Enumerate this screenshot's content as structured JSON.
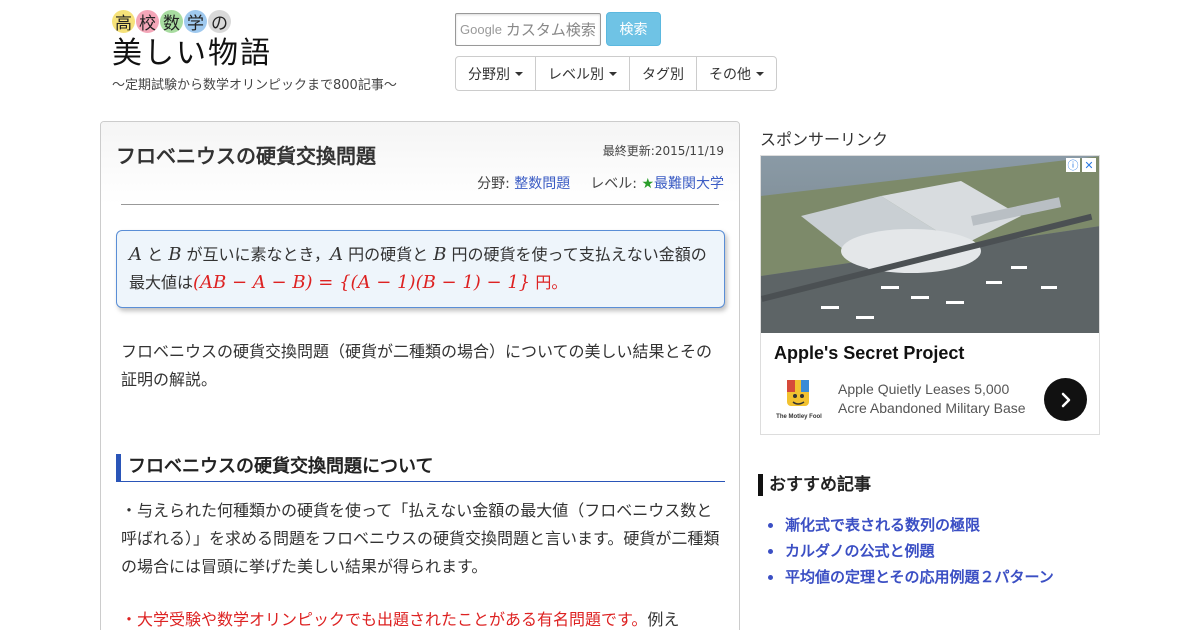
{
  "header": {
    "logo_chars": [
      "高",
      "校",
      "数",
      "学",
      "の"
    ],
    "logo_char_colors": [
      "#f6e27a",
      "#f4a6b8",
      "#a8dca0",
      "#9fc9ef",
      "#d9d9d9"
    ],
    "logo_title": "美しい物語",
    "tagline": "～定期試験から数学オリンピックまで800記事～",
    "search_brand": "Google",
    "search_placeholder": "カスタム検索",
    "search_button": "検索",
    "nav": [
      "分野別",
      "レベル別",
      "タグ別",
      "その他"
    ],
    "nav_has_caret": [
      true,
      true,
      false,
      true
    ]
  },
  "article": {
    "title": "フロベニウスの硬貨交換問題",
    "updated": "最終更新:2015/11/19",
    "category_label": "分野:",
    "category_value": "整数問題",
    "level_label": "レベル:",
    "level_star": "★",
    "level_value": "最難関大学",
    "theorem": {
      "var_a": "A",
      "t1": " と ",
      "var_b": "B",
      "t2": " が互いに素なとき，",
      "var_a2": "A",
      "t3": " 円の硬貨と ",
      "var_b2": "B",
      "t4": " 円の硬貨を使って支払えない金額の最大値は",
      "formula": "(AB − A − B) = {(A − 1)(B − 1) − 1}",
      "t5": " 円。"
    },
    "intro": "フロベニウスの硬貨交換問題（硬貨が二種類の場合）についての美しい結果とその証明の解説。",
    "section_heading": "フロベニウスの硬貨交換問題について",
    "para1": "・与えられた何種類かの硬貨を使って「払えない金額の最大値（フロベニウス数と呼ばれる）」を求める問題をフロベニウスの硬貨交換問題と言います。硬貨が二種類の場合には冒頭に挙げた美しい結果が得られます。",
    "para2_red": "・大学受験や数学オリンピックでも出題されたことがある有名問題です。",
    "para2_rest": "例え"
  },
  "sidebar": {
    "sponsor_label": "スポンサーリンク",
    "ad": {
      "title": "Apple's Secret Project",
      "text": "Apple Quietly Leases 5,000 Acre Abandoned Military Base",
      "logo_caption": "The Motley Fool",
      "info_icon": "ⓘ",
      "close_icon": "✕"
    },
    "recommended_heading": "おすすめ記事",
    "recommended": [
      "漸化式で表される数列の極限",
      "カルダノの公式と例題",
      "平均値の定理とその応用例題２パターン"
    ]
  }
}
